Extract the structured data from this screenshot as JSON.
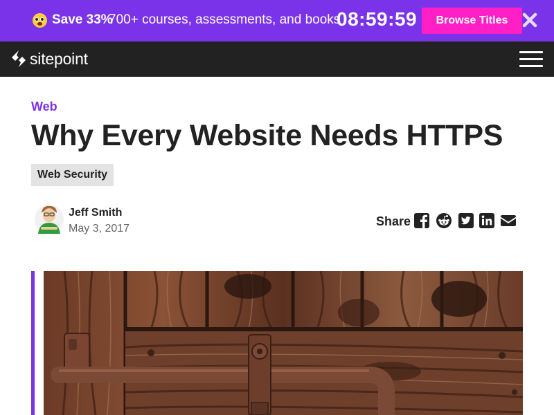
{
  "promo": {
    "emoji_icon": "astonished-face-icon",
    "save_label": "Save 33%",
    "description": "700+ courses, assessments, and books",
    "timer": "08:59:59",
    "button_label": "Browse Titles",
    "close_icon": "close-icon",
    "background_color": "#7b33ea",
    "button_color": "#ff1fc7"
  },
  "header": {
    "logo_icon": "sitepoint-logo-icon",
    "logo_text": "sitepoint",
    "menu_icon": "hamburger-menu-icon",
    "background_color": "#222222"
  },
  "article": {
    "category": "Web",
    "title": "Why Every Website Needs HTTPS",
    "tag": "Web Security",
    "author": {
      "name": "Jeff Smith",
      "date": "May 3, 2017"
    },
    "share": {
      "label": "Share",
      "icons": [
        "facebook-icon",
        "reddit-icon",
        "twitter-icon",
        "linkedin-icon",
        "email-icon"
      ]
    },
    "hero_image": "wooden-door-with-rusty-latch-image",
    "accent_color": "#7b33ea"
  }
}
